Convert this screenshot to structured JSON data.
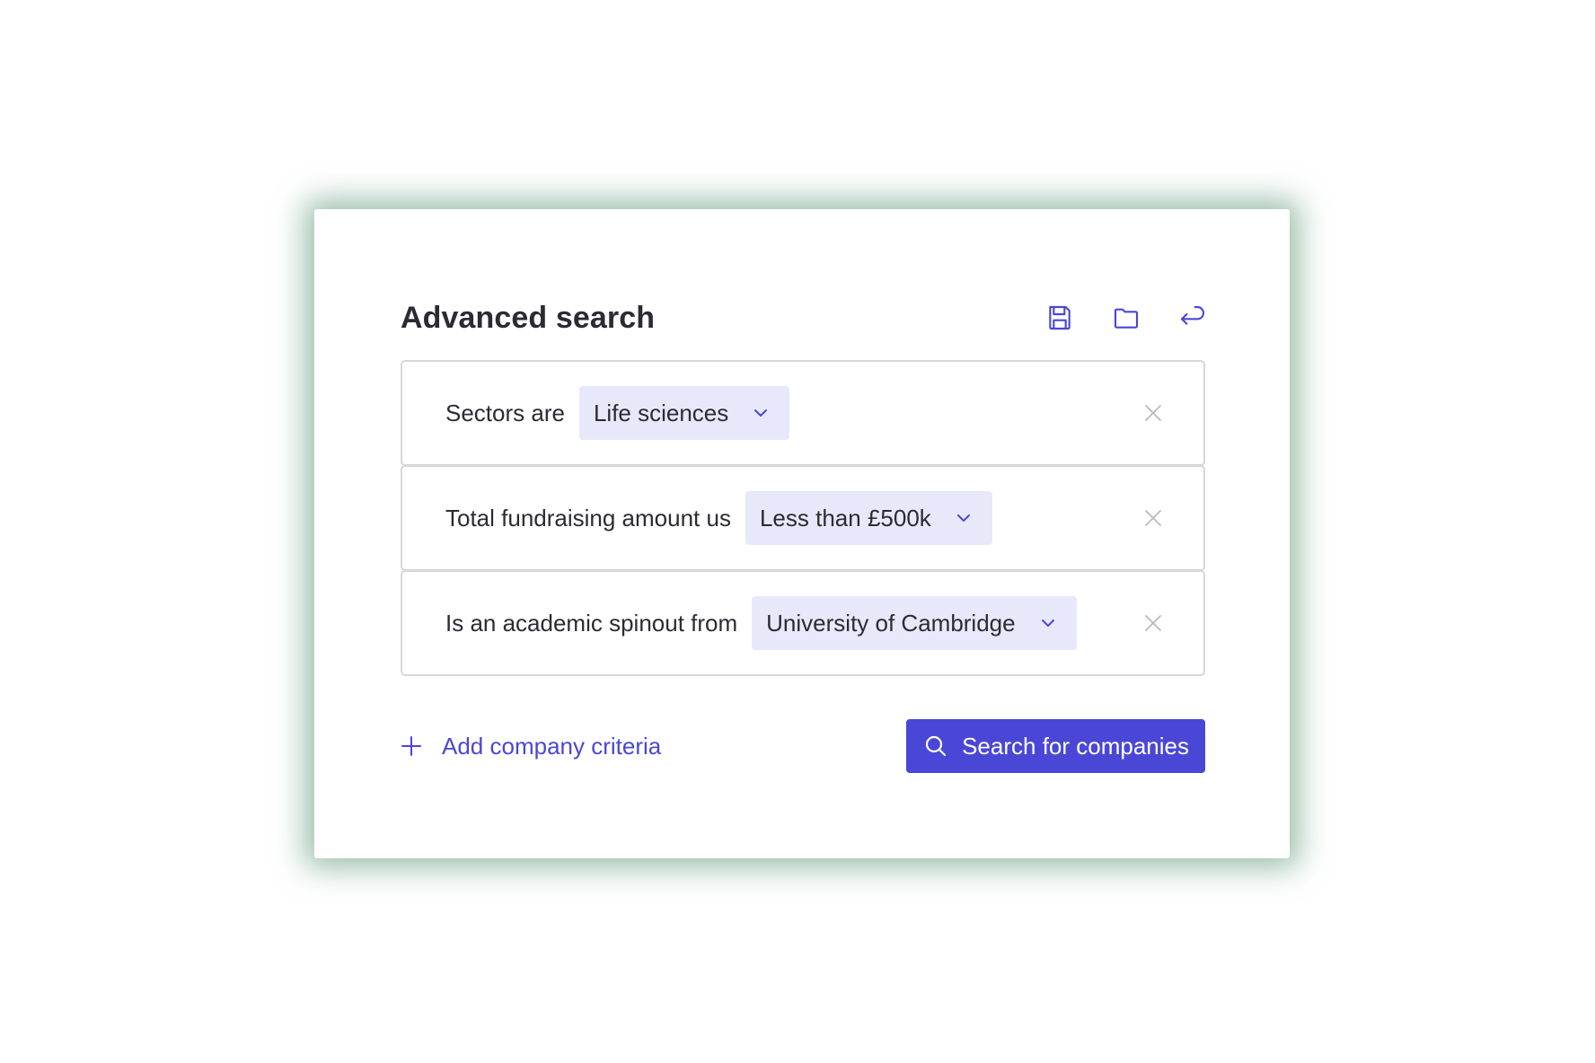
{
  "header": {
    "title": "Advanced search",
    "tools": [
      {
        "name": "save",
        "icon": "floppy-disk-icon"
      },
      {
        "name": "open",
        "icon": "folder-icon"
      },
      {
        "name": "undo",
        "icon": "return-arrow-icon"
      }
    ]
  },
  "criteria": [
    {
      "label": "Sectors are",
      "value": "Life sciences",
      "remove_icon": "close-icon"
    },
    {
      "label": "Total fundraising amount us",
      "value": "Less than £500k",
      "remove_icon": "close-icon"
    },
    {
      "label": "Is an academic spinout from",
      "value": "University of Cambridge",
      "remove_icon": "close-icon"
    }
  ],
  "footer": {
    "add_label": "Add company criteria",
    "search_label": "Search for companies"
  },
  "colors": {
    "accent": "#4a47d6",
    "dropdown_bg": "#e8e8fb",
    "border": "#d6d6dc",
    "text": "#2b2b33",
    "muted_icon": "#b9b9c2",
    "shadow": "#46875f"
  }
}
